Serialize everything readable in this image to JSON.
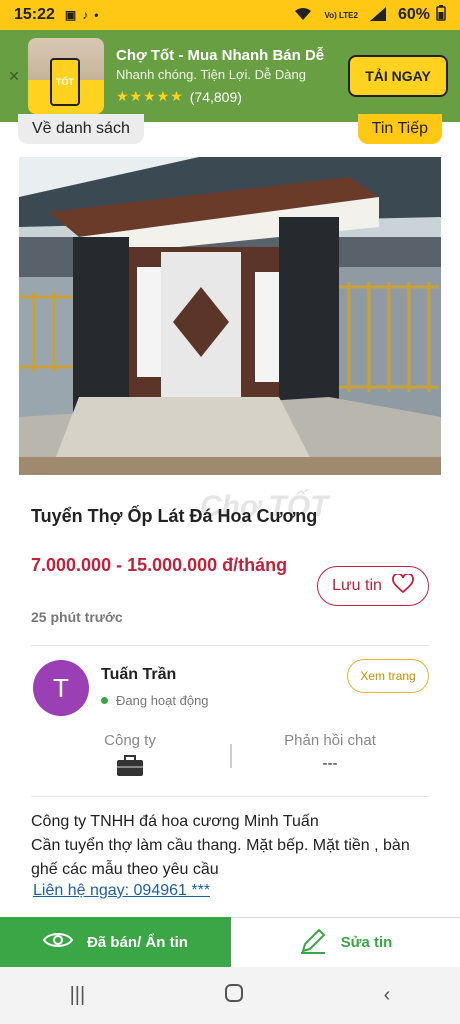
{
  "status_bar": {
    "time": "15:22",
    "battery": "60%",
    "network": "Vo) LTE2"
  },
  "ad": {
    "title": "Chợ Tốt - Mua Nhanh Bán Dễ",
    "subtitle": "Nhanh chóng. Tiện Lợi. Dễ Dàng",
    "rating_count": "(74,809)",
    "stars": "★★★★★",
    "cta_label": "TẢI NGAY",
    "app_logo_text": "TỐT"
  },
  "nav": {
    "back_label": "Về danh sách",
    "next_label": "Tin Tiếp"
  },
  "listing": {
    "title": "Tuyển Thợ Ốp Lát Đá Hoa Cương",
    "price": "7.000.000 - 15.000.000 đ/tháng",
    "time_ago": "25 phút trước",
    "save_label": "Lưu tin",
    "watermark": "Chợ TỐT"
  },
  "seller": {
    "avatar_letter": "T",
    "name": "Tuấn Trần",
    "status": "Đang hoạt động",
    "view_page_label": "Xem trang",
    "company_label": "Công ty",
    "chat_label": "Phản hồi chat",
    "chat_value": "---"
  },
  "description": {
    "line1": "Công ty TNHH đá hoa cương Minh Tuấn",
    "line2": "Cần tuyển thợ làm cầu thang. Mặt bếp. Mặt tiền , bàn ghế các mẫu theo yêu cầu",
    "contact": "Liên hệ ngay: 094961 ***"
  },
  "actions": {
    "sold_label": "Đã bán/ Ẩn tin",
    "edit_label": "Sửa tin"
  },
  "colors": {
    "accent": "#ffc814",
    "price": "#c0223b",
    "green": "#3aa646"
  }
}
